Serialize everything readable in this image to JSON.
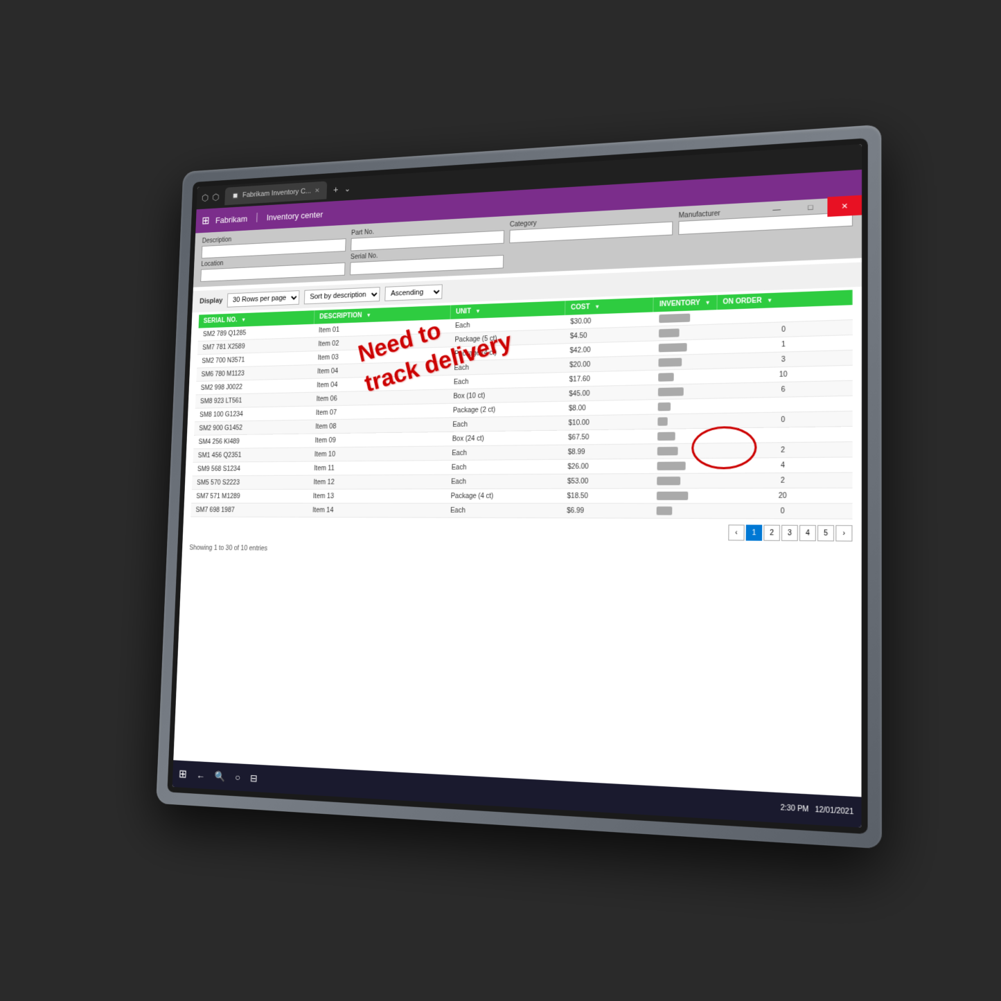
{
  "browser": {
    "tab_title": "Fabrikam Inventory C...",
    "tab_icon": "🔲"
  },
  "app": {
    "brand": "Fabrikam",
    "separator": "|",
    "module": "Inventory center"
  },
  "window_controls": {
    "minimize": "—",
    "maximize": "□",
    "close": "✕"
  },
  "filters": {
    "description_label": "Description",
    "part_no_label": "Part No.",
    "category_label": "Category",
    "manufacturer_label": "Manufacturer",
    "location_label": "Location",
    "serial_no_label": "Serial No."
  },
  "toolbar": {
    "display_label": "Display",
    "rows_option": "30 Rows per page",
    "sort_label": "Sort by description",
    "sort_direction": "Ascending"
  },
  "table": {
    "columns": [
      "SERIAL NO.",
      "DESCRIPTION",
      "UNIT",
      "COST",
      "INVENTORY",
      "ON ORDER"
    ],
    "rows": [
      {
        "serial": "SM2 789 Q1285",
        "description": "Item 01",
        "unit": "Each",
        "cost": "$30.00",
        "inventory": 60,
        "on_order": ""
      },
      {
        "serial": "SM7 781 X2589",
        "description": "Item 02",
        "unit": "Package (5 ct)",
        "cost": "$4.50",
        "inventory": 40,
        "on_order": "0"
      },
      {
        "serial": "SM2 700 N3571",
        "description": "Item 03",
        "unit": "Package (4 ct)",
        "cost": "$42.00",
        "inventory": 55,
        "on_order": "1"
      },
      {
        "serial": "SM6 780 M1123",
        "description": "Item 04",
        "unit": "Each",
        "cost": "$20.00",
        "inventory": 45,
        "on_order": "3"
      },
      {
        "serial": "SM2 998 J0022",
        "description": "Item 04",
        "unit": "Each",
        "cost": "$17.60",
        "inventory": 30,
        "on_order": "10"
      },
      {
        "serial": "SM8 923 LT561",
        "description": "Item 06",
        "unit": "Box (10 ct)",
        "cost": "$45.00",
        "inventory": 50,
        "on_order": "6"
      },
      {
        "serial": "SM8 100 G1234",
        "description": "Item 07",
        "unit": "Package (2 ct)",
        "cost": "$8.00",
        "inventory": 25,
        "on_order": ""
      },
      {
        "serial": "SM2 900 G1452",
        "description": "Item 08",
        "unit": "Each",
        "cost": "$10.00",
        "inventory": 20,
        "on_order": "0"
      },
      {
        "serial": "SM4 256 KI489",
        "description": "Item 09",
        "unit": "Box (24 ct)",
        "cost": "$67.50",
        "inventory": 35,
        "on_order": ""
      },
      {
        "serial": "SM1 456 Q2351",
        "description": "Item 10",
        "unit": "Each",
        "cost": "$8.99",
        "inventory": 40,
        "on_order": "2"
      },
      {
        "serial": "SM9 568 S1234",
        "description": "Item 11",
        "unit": "Each",
        "cost": "$26.00",
        "inventory": 55,
        "on_order": "4"
      },
      {
        "serial": "SM5 570 S2223",
        "description": "Item 12",
        "unit": "Each",
        "cost": "$53.00",
        "inventory": 45,
        "on_order": "2"
      },
      {
        "serial": "SM7 571 M1289",
        "description": "Item 13",
        "unit": "Package (4 ct)",
        "cost": "$18.50",
        "inventory": 60,
        "on_order": "20"
      },
      {
        "serial": "SM7 698 1987",
        "description": "Item 14",
        "unit": "Each",
        "cost": "$6.99",
        "inventory": 30,
        "on_order": "0"
      }
    ]
  },
  "pagination": {
    "prev": "‹",
    "pages": [
      "1",
      "2",
      "3",
      "4",
      "5"
    ],
    "next": "›",
    "active_page": "1"
  },
  "status": {
    "showing": "Showing 1 to 30 of 10 entries"
  },
  "annotation": {
    "line1": "Need to",
    "line2": "track delivery"
  },
  "taskbar": {
    "time": "2:30 PM",
    "date": "12/01/2021"
  }
}
